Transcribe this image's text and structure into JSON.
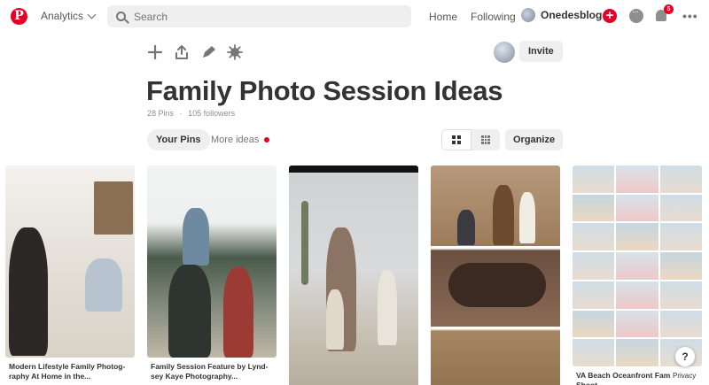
{
  "nav": {
    "logo": "P",
    "analytics_label": "Analytics",
    "search_placeholder": "Search",
    "home": "Home",
    "following": "Following",
    "username": "Onedesblog",
    "notification_count": "5",
    "more": "•••"
  },
  "board": {
    "title": "Family Photo Session Ideas",
    "pins_count": "28 Pins",
    "followers": "105 followers",
    "separator": "·",
    "invite_label": "Invite",
    "tools": [
      "plus-icon",
      "share-icon",
      "pencil-icon",
      "settings-icon"
    ]
  },
  "tabs": {
    "your_pins": "Your Pins",
    "more_ideas": "More ideas",
    "organize": "Organize"
  },
  "pins": [
    {
      "caption": "Modern Lifestyle Family Photog-raphy At Home in the..."
    },
    {
      "caption": "Family Session Feature by Lynd-sey Kaye Photography..."
    },
    {
      "caption": ""
    },
    {
      "caption": ""
    },
    {
      "caption": "VA Beach Oceanfront Fam to Shoot"
    }
  ],
  "help": {
    "question": "?",
    "privacy": "Privacy"
  },
  "colors": {
    "brand_red": "#e60023",
    "chip_gray": "#efefef",
    "text_dark": "#333333"
  }
}
